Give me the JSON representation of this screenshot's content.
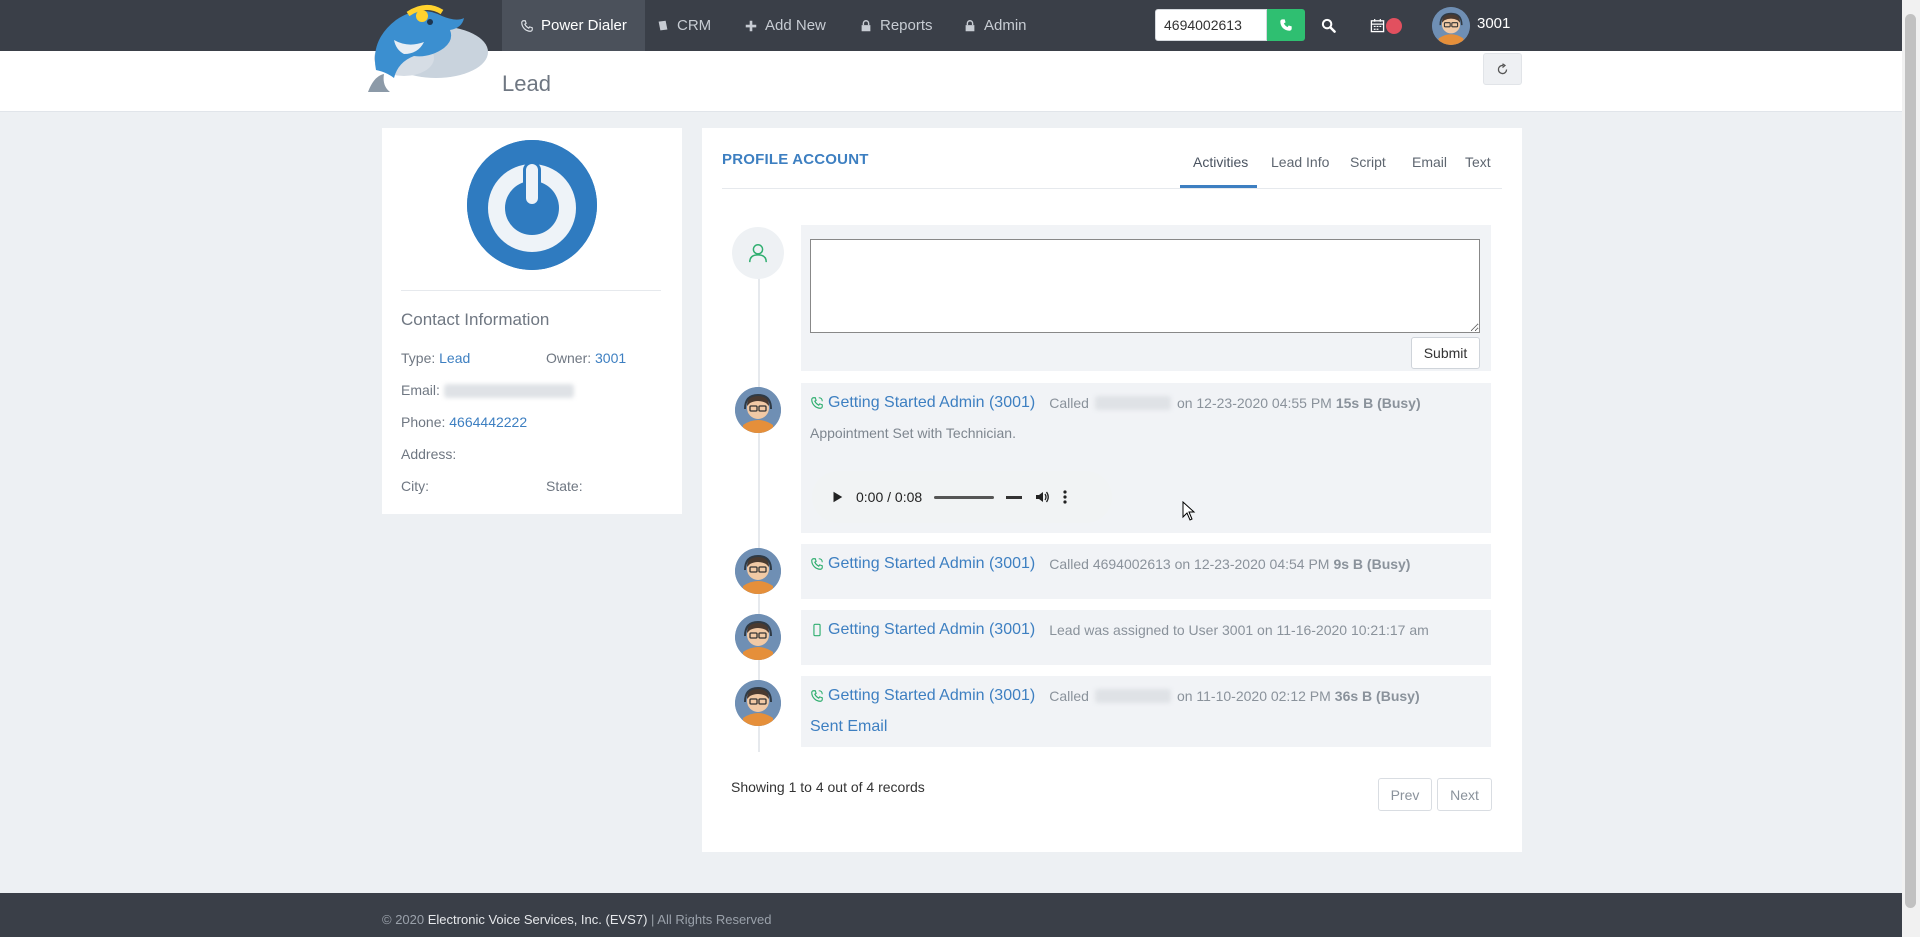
{
  "nav": {
    "items": [
      {
        "label": "Power Dialer",
        "icon": "phone-outline-icon"
      },
      {
        "label": "CRM",
        "icon": "book-icon"
      },
      {
        "label": "Add New",
        "icon": "plus-icon"
      },
      {
        "label": "Reports",
        "icon": "lock-icon"
      },
      {
        "label": "Admin",
        "icon": "lock-icon"
      }
    ],
    "dial_value": "4694002613",
    "user": "3001"
  },
  "page": {
    "title": "Lead"
  },
  "contact": {
    "title": "Contact Information",
    "type_label": "Type:",
    "type_value": "Lead",
    "owner_label": "Owner:",
    "owner_value": "3001",
    "email_label": "Email:",
    "phone_label": "Phone:",
    "phone_value": "4664442222",
    "address_label": "Address:",
    "city_label": "City:",
    "state_label": "State:"
  },
  "profile": {
    "title": "PROFILE ACCOUNT",
    "tabs": [
      "Activities",
      "Lead Info",
      "Script",
      "Email",
      "Text"
    ],
    "submit_label": "Submit"
  },
  "activities": [
    {
      "who": "Getting Started Admin (3001)",
      "text_a": "Called",
      "text_b": "on 12-23-2020 04:55 PM",
      "duration": "15s B (Busy)",
      "note": "Appointment Set with Technician.",
      "audio_time": "0:00 / 0:08"
    },
    {
      "who": "Getting Started Admin (3001)",
      "text_a": "Called 4694002613 on 12-23-2020 04:54 PM",
      "duration": "9s B (Busy)"
    },
    {
      "who": "Getting Started Admin (3001)",
      "text_a": "Lead was assigned to User 3001 on 11-16-2020 10:21:17 am"
    },
    {
      "who": "Getting Started Admin (3001)",
      "text_a": "Called",
      "text_b": "on 11-10-2020 02:12 PM",
      "duration": "36s B (Busy)",
      "sent_email": "Sent Email"
    }
  ],
  "pagination": {
    "showing": "Showing 1 to 4 out of 4 records",
    "prev": "Prev",
    "next": "Next"
  },
  "footer": {
    "prefix": "© 2020",
    "company": "Electronic Voice Services, Inc. (EVS7)",
    "suffix": "| All Rights Reserved"
  },
  "colors": {
    "nav_bg": "#3a3f48",
    "accent": "#3d7fc1",
    "call_green": "#2fbf71",
    "badge_red": "#e2505f"
  }
}
